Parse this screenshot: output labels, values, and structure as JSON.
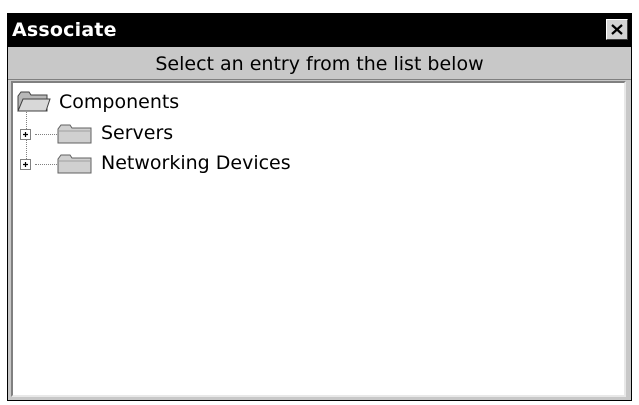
{
  "window": {
    "title": "Associate",
    "close_icon": "close-icon"
  },
  "instruction": "Select an entry from the list below",
  "tree": {
    "root": {
      "label": "Components",
      "icon": "folder-open-icon"
    },
    "children": [
      {
        "label": "Servers",
        "icon": "folder-icon",
        "expander": "plus"
      },
      {
        "label": "Networking Devices",
        "icon": "folder-icon",
        "expander": "plus"
      }
    ]
  }
}
